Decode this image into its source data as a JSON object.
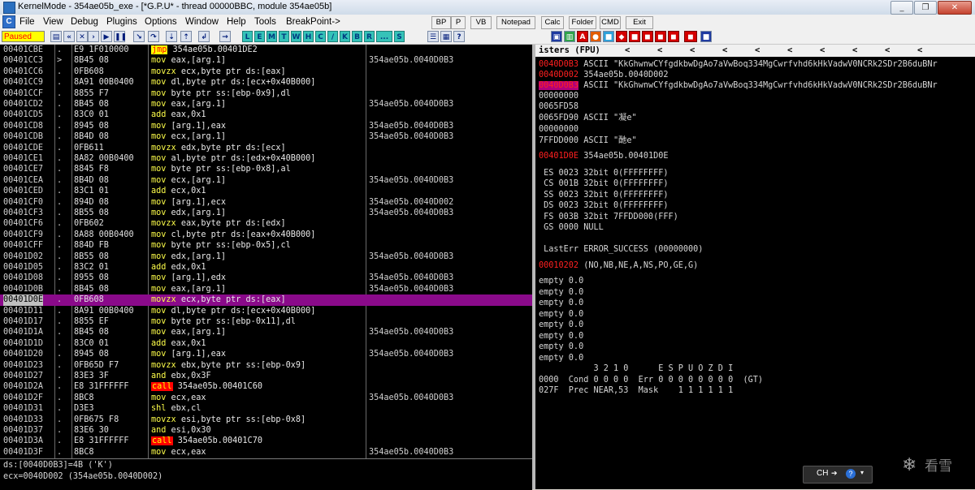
{
  "window": {
    "title": "KernelMode - 354ae05b_exe - [*G.P.U* - thread 00000BBC, module 354ae05b]",
    "controls": [
      "_",
      "❐",
      "✕"
    ]
  },
  "menu": {
    "icon": "C",
    "items": [
      "File",
      "View",
      "Debug",
      "Plugins",
      "Options",
      "Window",
      "Help",
      "Tools",
      "BreakPoint->"
    ]
  },
  "quick_buttons": [
    "BP",
    "P",
    "VB",
    "Notepad",
    "Calc",
    "Folder",
    "CMD",
    "Exit"
  ],
  "toolbar": {
    "status": "Paused",
    "letters": [
      "L",
      "E",
      "M",
      "T",
      "W",
      "H",
      "C",
      "/",
      "K",
      "B",
      "R",
      "...",
      "S"
    ]
  },
  "cpu": {
    "rows": [
      {
        "addr": "00401CBE",
        "mark": ".",
        "hex": "E9 1F010000",
        "op": "jmp",
        "args": "354ae05b.00401DE2",
        "cmt": "",
        "cls": "jmp"
      },
      {
        "addr": "00401CC3",
        "mark": ">",
        "hex": "8B45 08",
        "op": "mov",
        "args": "eax,[arg.1]",
        "cmt": "354ae05b.0040D0B3",
        "cls": ""
      },
      {
        "addr": "00401CC6",
        "mark": ".",
        "hex": "0FB608",
        "op": "movzx",
        "args": "ecx,byte ptr ds:[eax]",
        "cmt": "",
        "cls": ""
      },
      {
        "addr": "00401CC9",
        "mark": ".",
        "hex": "8A91 00B0400",
        "op": "mov",
        "args": "dl,byte ptr ds:[ecx+0x40B000]",
        "cmt": "",
        "cls": ""
      },
      {
        "addr": "00401CCF",
        "mark": ".",
        "hex": "8855 F7",
        "op": "mov",
        "args": "byte ptr ss:[ebp-0x9],dl",
        "cmt": "",
        "cls": ""
      },
      {
        "addr": "00401CD2",
        "mark": ".",
        "hex": "8B45 08",
        "op": "mov",
        "args": "eax,[arg.1]",
        "cmt": "354ae05b.0040D0B3",
        "cls": ""
      },
      {
        "addr": "00401CD5",
        "mark": ".",
        "hex": "83C0 01",
        "op": "add",
        "args": "eax,0x1",
        "cmt": "",
        "cls": ""
      },
      {
        "addr": "00401CD8",
        "mark": ".",
        "hex": "8945 08",
        "op": "mov",
        "args": "[arg.1],eax",
        "cmt": "354ae05b.0040D0B3",
        "cls": ""
      },
      {
        "addr": "00401CDB",
        "mark": ".",
        "hex": "8B4D 08",
        "op": "mov",
        "args": "ecx,[arg.1]",
        "cmt": "354ae05b.0040D0B3",
        "cls": ""
      },
      {
        "addr": "00401CDE",
        "mark": ".",
        "hex": "0FB611",
        "op": "movzx",
        "args": "edx,byte ptr ds:[ecx]",
        "cmt": "",
        "cls": ""
      },
      {
        "addr": "00401CE1",
        "mark": ".",
        "hex": "8A82 00B0400",
        "op": "mov",
        "args": "al,byte ptr ds:[edx+0x40B000]",
        "cmt": "",
        "cls": ""
      },
      {
        "addr": "00401CE7",
        "mark": ".",
        "hex": "8845 F8",
        "op": "mov",
        "args": "byte ptr ss:[ebp-0x8],al",
        "cmt": "",
        "cls": ""
      },
      {
        "addr": "00401CEA",
        "mark": ".",
        "hex": "8B4D 08",
        "op": "mov",
        "args": "ecx,[arg.1]",
        "cmt": "354ae05b.0040D0B3",
        "cls": ""
      },
      {
        "addr": "00401CED",
        "mark": ".",
        "hex": "83C1 01",
        "op": "add",
        "args": "ecx,0x1",
        "cmt": "",
        "cls": ""
      },
      {
        "addr": "00401CF0",
        "mark": ".",
        "hex": "894D 08",
        "op": "mov",
        "args": "[arg.1],ecx",
        "cmt": "354ae05b.0040D002",
        "cls": ""
      },
      {
        "addr": "00401CF3",
        "mark": ".",
        "hex": "8B55 08",
        "op": "mov",
        "args": "edx,[arg.1]",
        "cmt": "354ae05b.0040D0B3",
        "cls": ""
      },
      {
        "addr": "00401CF6",
        "mark": ".",
        "hex": "0FB602",
        "op": "movzx",
        "args": "eax,byte ptr ds:[edx]",
        "cmt": "",
        "cls": ""
      },
      {
        "addr": "00401CF9",
        "mark": ".",
        "hex": "8A88 00B0400",
        "op": "mov",
        "args": "cl,byte ptr ds:[eax+0x40B000]",
        "cmt": "",
        "cls": ""
      },
      {
        "addr": "00401CFF",
        "mark": ".",
        "hex": "884D FB",
        "op": "mov",
        "args": "byte ptr ss:[ebp-0x5],cl",
        "cmt": "",
        "cls": ""
      },
      {
        "addr": "00401D02",
        "mark": ".",
        "hex": "8B55 08",
        "op": "mov",
        "args": "edx,[arg.1]",
        "cmt": "354ae05b.0040D0B3",
        "cls": ""
      },
      {
        "addr": "00401D05",
        "mark": ".",
        "hex": "83C2 01",
        "op": "add",
        "args": "edx,0x1",
        "cmt": "",
        "cls": ""
      },
      {
        "addr": "00401D08",
        "mark": ".",
        "hex": "8955 08",
        "op": "mov",
        "args": "[arg.1],edx",
        "cmt": "354ae05b.0040D0B3",
        "cls": ""
      },
      {
        "addr": "00401D0B",
        "mark": ".",
        "hex": "8B45 08",
        "op": "mov",
        "args": "eax,[arg.1]",
        "cmt": "354ae05b.0040D0B3",
        "cls": ""
      },
      {
        "addr": "00401D0E",
        "mark": ".",
        "hex": "0FB608",
        "op": "movzx",
        "args": "ecx,byte ptr ds:[eax]",
        "cmt": "",
        "cls": "sel"
      },
      {
        "addr": "00401D11",
        "mark": ".",
        "hex": "8A91 00B0400",
        "op": "mov",
        "args": "dl,byte ptr ds:[ecx+0x40B000]",
        "cmt": "",
        "cls": ""
      },
      {
        "addr": "00401D17",
        "mark": ".",
        "hex": "8855 EF",
        "op": "mov",
        "args": "byte ptr ss:[ebp-0x11],dl",
        "cmt": "",
        "cls": ""
      },
      {
        "addr": "00401D1A",
        "mark": ".",
        "hex": "8B45 08",
        "op": "mov",
        "args": "eax,[arg.1]",
        "cmt": "354ae05b.0040D0B3",
        "cls": ""
      },
      {
        "addr": "00401D1D",
        "mark": ".",
        "hex": "83C0 01",
        "op": "add",
        "args": "eax,0x1",
        "cmt": "",
        "cls": ""
      },
      {
        "addr": "00401D20",
        "mark": ".",
        "hex": "8945 08",
        "op": "mov",
        "args": "[arg.1],eax",
        "cmt": "354ae05b.0040D0B3",
        "cls": ""
      },
      {
        "addr": "00401D23",
        "mark": ".",
        "hex": "0FB65D F7",
        "op": "movzx",
        "args": "ebx,byte ptr ss:[ebp-0x9]",
        "cmt": "",
        "cls": ""
      },
      {
        "addr": "00401D27",
        "mark": ".",
        "hex": "83E3 3F",
        "op": "and",
        "args": "ebx,0x3F",
        "cmt": "",
        "cls": ""
      },
      {
        "addr": "00401D2A",
        "mark": ".",
        "hex": "E8 31FFFFFF",
        "op": "call",
        "args": "354ae05b.00401C60",
        "cmt": "",
        "cls": "call"
      },
      {
        "addr": "00401D2F",
        "mark": ".",
        "hex": "8BC8",
        "op": "mov",
        "args": "ecx,eax",
        "cmt": "354ae05b.0040D0B3",
        "cls": ""
      },
      {
        "addr": "00401D31",
        "mark": ".",
        "hex": "D3E3",
        "op": "shl",
        "args": "ebx,cl",
        "cmt": "",
        "cls": ""
      },
      {
        "addr": "00401D33",
        "mark": ".",
        "hex": "0FB675 F8",
        "op": "movzx",
        "args": "esi,byte ptr ss:[ebp-0x8]",
        "cmt": "",
        "cls": ""
      },
      {
        "addr": "00401D37",
        "mark": ".",
        "hex": "83E6 30",
        "op": "and",
        "args": "esi,0x30",
        "cmt": "",
        "cls": ""
      },
      {
        "addr": "00401D3A",
        "mark": ".",
        "hex": "E8 31FFFFFF",
        "op": "call",
        "args": "354ae05b.00401C70",
        "cmt": "",
        "cls": "call"
      },
      {
        "addr": "00401D3F",
        "mark": ".",
        "hex": "8BC8",
        "op": "mov",
        "args": "ecx,eax",
        "cmt": "354ae05b.0040D0B3",
        "cls": ""
      }
    ],
    "info_lines": [
      "ds:[0040D0B3]=4B ('K')",
      "ecx=0040D002 (354ae05b.0040D002)"
    ]
  },
  "registers": {
    "title": "isters (FPU)",
    "arrows": [
      "<",
      "<",
      "<",
      "<",
      "<",
      "<",
      "<",
      "<",
      "<",
      "<"
    ],
    "lines": [
      {
        "name": "0040D0B3",
        "text": "ASCII \"KkGhwnwCYfgdkbwDgAo7aVwBoq334MgCwrfvhd6kHkVadwV0NCRk2SDr2B6duBNr",
        "style": "red"
      },
      {
        "name": "0040D002",
        "text": "354ae05b.0040D002",
        "style": "red"
      },
      {
        "name": "0040D0B3",
        "text": "ASCII \"KkGhwnwCYfgdkbwDgAo7aVwBoq334MgCwrfvhd6kHkVadwV0NCRk2SDr2B6duBNr",
        "style": "box"
      },
      {
        "name": "",
        "text": "00000000",
        "style": "plain"
      },
      {
        "name": "",
        "text": "0065FD58",
        "style": "plain"
      },
      {
        "name": "",
        "text": "0065FD90 ASCII \"凝e\"",
        "style": "plain"
      },
      {
        "name": "",
        "text": "00000000",
        "style": "plain"
      },
      {
        "name": "",
        "text": "7FFDD000 ASCII \"酏e\"",
        "style": "plain"
      },
      {
        "name": "00401D0E",
        "text": "354ae05b.00401D0E",
        "style": "red"
      },
      {
        "name": "",
        "text": " ES 0023 32bit 0(FFFFFFFF)",
        "style": "plain"
      },
      {
        "name": "",
        "text": " CS 001B 32bit 0(FFFFFFFF)",
        "style": "plain"
      },
      {
        "name": "",
        "text": " SS 0023 32bit 0(FFFFFFFF)",
        "style": "plain"
      },
      {
        "name": "",
        "text": " DS 0023 32bit 0(FFFFFFFF)",
        "style": "plain"
      },
      {
        "name": "",
        "text": " FS 003B 32bit 7FFDD000(FFF)",
        "style": "plain"
      },
      {
        "name": "",
        "text": " GS 0000 NULL",
        "style": "plain"
      },
      {
        "name": "",
        "text": " LastErr ERROR_SUCCESS (00000000)",
        "style": "plain"
      },
      {
        "name": "00010202",
        "text": "(NO,NB,NE,A,NS,PO,GE,G)",
        "style": "red"
      },
      {
        "name": "",
        "text": "empty 0.0",
        "style": "plain"
      },
      {
        "name": "",
        "text": "empty 0.0",
        "style": "plain"
      },
      {
        "name": "",
        "text": "empty 0.0",
        "style": "plain"
      },
      {
        "name": "",
        "text": "empty 0.0",
        "style": "plain"
      },
      {
        "name": "",
        "text": "empty 0.0",
        "style": "plain"
      },
      {
        "name": "",
        "text": "empty 0.0",
        "style": "plain"
      },
      {
        "name": "",
        "text": "empty 0.0",
        "style": "plain"
      },
      {
        "name": "",
        "text": "empty 0.0",
        "style": "plain"
      },
      {
        "name": "",
        "text": "           3 2 1 0      E S P U O Z D I",
        "style": "plain"
      },
      {
        "name": "",
        "text": "0000  Cond 0 0 0 0  Err 0 0 0 0 0 0 0 0  (GT)",
        "style": "plain"
      },
      {
        "name": "",
        "text": "027F  Prec NEAR,53  Mask    1 1 1 1 1 1",
        "style": "plain"
      }
    ]
  },
  "ime": {
    "lang": "CH"
  },
  "watermark": {
    "text": "看雪"
  },
  "colors": {
    "selection": "#8a0a8a",
    "paused_bg": "#ffff00",
    "reg_changed": "#ff2020"
  }
}
